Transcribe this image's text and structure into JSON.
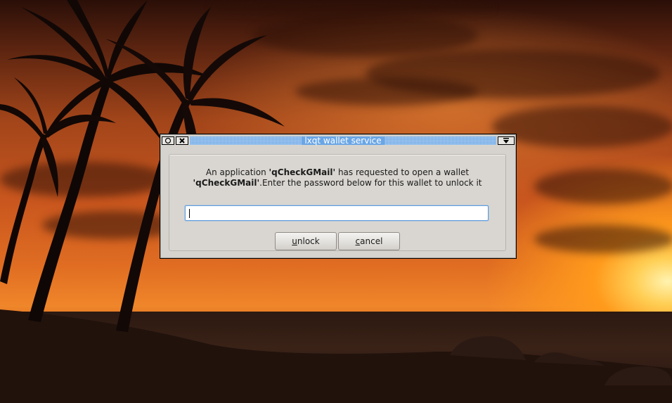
{
  "dialog": {
    "title": "lxqt wallet service",
    "message_prefix": "An application ",
    "app_name": "'qCheckGMail'",
    "message_middle": " has requested to open a wallet",
    "wallet_name": "'qCheckGMail'",
    "message_suffix": ".Enter the password below for this wallet to unlock it",
    "password_value": "",
    "unlock_label": "unlock",
    "cancel_label": "cancel"
  },
  "titlebar": {
    "icons": [
      "window-menu-icon",
      "close-icon",
      "shade-icon"
    ]
  },
  "colors": {
    "titlebar_accent": "#6aa6e6",
    "dialog_bg": "#d6d3ce",
    "focus_border": "#5f9fe0"
  }
}
